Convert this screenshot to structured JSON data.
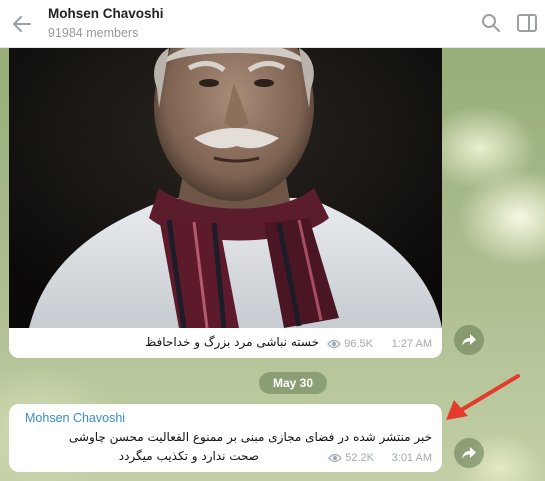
{
  "header": {
    "title": "Mohsen Chavoshi",
    "members": "91984 members"
  },
  "messages": [
    {
      "type": "photo",
      "caption": "خسته نباشی مرد بزرگ و خداحافظ",
      "views": "96.5K",
      "time": "1:27 AM"
    },
    {
      "type": "text",
      "sender": "Mohsen Chavoshi",
      "line1": "خبر منتشر شده در فضای مجازی مبنی بر ممنوع الفعالیت محسن چاوشی",
      "line2": "صحت ندارد و تکذیب میگردد",
      "views": "52.2K",
      "time": "3:01 AM"
    }
  ],
  "date_separator": "May 30",
  "icons": {
    "back": "back-arrow-icon",
    "search": "search-icon",
    "sidebar": "sidebar-toggle-icon",
    "forward": "forward-icon",
    "views": "eye-icon"
  },
  "colors": {
    "sender": "#3a8dcc",
    "meta": "#a0aab0",
    "annotation_arrow": "#e53b2c"
  }
}
